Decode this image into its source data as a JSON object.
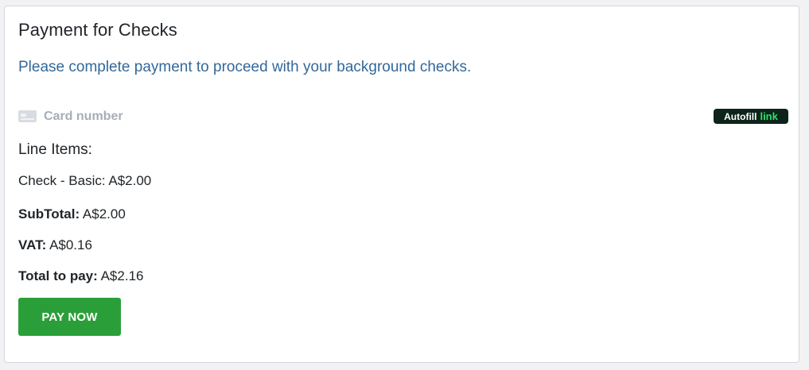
{
  "payment": {
    "title": "Payment for Checks",
    "subtitle": "Please complete payment to proceed with your background checks.",
    "card_field": {
      "placeholder": "Card number",
      "icon": "credit-card-icon"
    },
    "autofill": {
      "label": "Autofill",
      "brand": "link",
      "bg_color": "#0c2419",
      "brand_color": "#2fe06e"
    },
    "line_items_heading": "Line Items:",
    "line_items": [
      {
        "text": "Check - Basic: A$2.00"
      }
    ],
    "subtotal": {
      "label": "SubTotal:",
      "value": "A$2.00"
    },
    "vat": {
      "label": "VAT:",
      "value": "A$0.16"
    },
    "total": {
      "label": "Total to pay:",
      "value": "A$2.16"
    },
    "pay_button": {
      "label": "PAY NOW",
      "color": "#2a9f39"
    },
    "accent_color": "#33689a"
  }
}
